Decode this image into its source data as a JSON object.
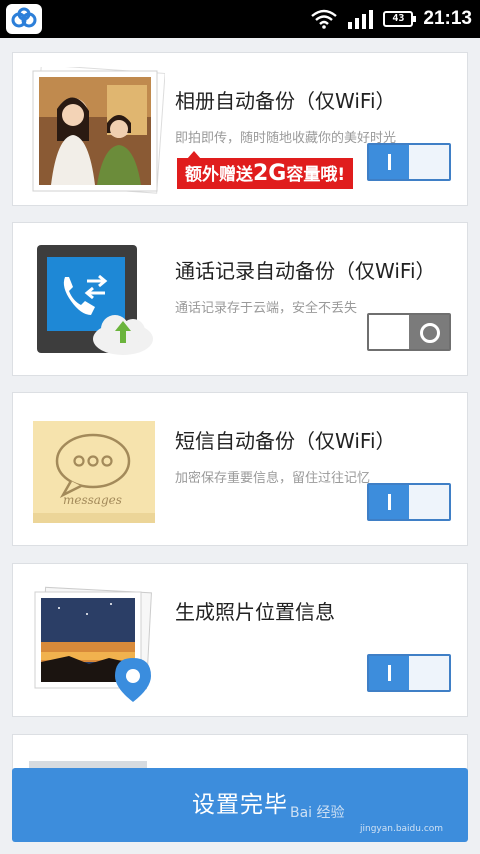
{
  "statusbar": {
    "app_icon": "baidu-cloud-icon",
    "battery": "43",
    "time": "21:13"
  },
  "cards": [
    {
      "title": "相册自动备份（仅WiFi）",
      "subtitle": "即拍即传，随时随地收藏你的美好时光",
      "promo_pre": "额外赠送",
      "promo_big": "2G",
      "promo_post": "容量哦!",
      "toggle": "on",
      "icon": "photo-album-icon"
    },
    {
      "title": "通话记录自动备份（仅WiFi）",
      "subtitle": "通话记录存于云端，安全不丢失",
      "toggle": "off",
      "icon": "call-log-icon"
    },
    {
      "title": "短信自动备份（仅WiFi）",
      "subtitle": "加密保存重要信息，留住过往记忆",
      "icon_caption": "messages",
      "toggle": "on",
      "icon": "messages-icon"
    },
    {
      "title": "生成照片位置信息",
      "toggle": "on",
      "icon": "photo-location-icon"
    }
  ],
  "bottom_button": "设置完毕",
  "watermark": {
    "text": "Bai 经验",
    "url": "jingyan.baidu.com"
  },
  "colors": {
    "accent": "#3d8ddc",
    "promo_red": "#e01d1d",
    "background": "#eef0f3"
  }
}
